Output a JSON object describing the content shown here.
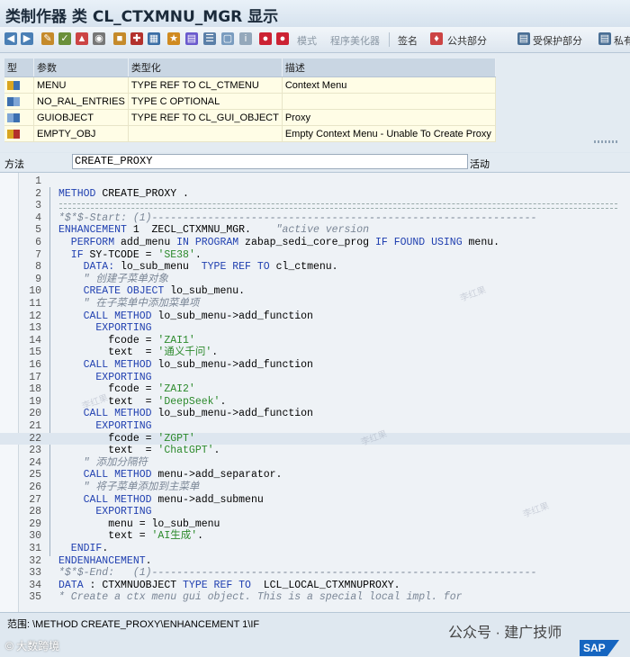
{
  "window": {
    "title": "类制作器 类 CL_CTXMNU_MGR 显示"
  },
  "toolbar": {
    "mode_label": "模式",
    "pretty_printer_label": "程序美化器",
    "signature_label": "签名",
    "public_section_label": "公共部分",
    "protected_section_label": "受保护部分",
    "private_section_label": "私有"
  },
  "params": {
    "headers": [
      "型",
      "参数",
      "类型化",
      "描述"
    ],
    "rows": [
      {
        "name": "MENU",
        "typing": "TYPE REF TO CL_CTMENU",
        "desc": "Context Menu"
      },
      {
        "name": "NO_RAL_ENTRIES",
        "typing": "TYPE C OPTIONAL",
        "desc": ""
      },
      {
        "name": "GUIOBJECT",
        "typing": "TYPE REF TO CL_GUI_OBJECT",
        "desc": "Proxy"
      },
      {
        "name": "EMPTY_OBJ",
        "typing": "",
        "desc": "Empty Context Menu - Unable To Create Proxy"
      }
    ]
  },
  "method_bar": {
    "label": "方法",
    "value": "CREATE_PROXY",
    "status": "活动"
  },
  "code_lines": [
    {
      "n": "1",
      "t": [
        [
          "",
          ""
        ]
      ]
    },
    {
      "n": "2",
      "t": [
        [
          "kw",
          "METHOD"
        ],
        [
          "plain",
          " CREATE_PROXY ."
        ]
      ]
    },
    {
      "n": "3",
      "t": [
        [
          "",
          ""
        ]
      ]
    },
    {
      "n": "4",
      "t": [
        [
          "cmt",
          "*$*$-Start: (1)--------------------------------------------------------------"
        ]
      ]
    },
    {
      "n": "5",
      "t": [
        [
          "kw",
          "ENHANCEMENT"
        ],
        [
          "plain",
          " 1  ZECL_CTXMNU_MGR.    "
        ],
        [
          "cmt",
          "\"active version"
        ]
      ]
    },
    {
      "n": "6",
      "t": [
        [
          "kw",
          "  PERFORM"
        ],
        [
          "plain",
          " add_menu "
        ],
        [
          "kw",
          "IN PROGRAM"
        ],
        [
          "plain",
          " zabap_sedi_core_prog "
        ],
        [
          "kw",
          "IF FOUND USING"
        ],
        [
          "plain",
          " menu."
        ]
      ]
    },
    {
      "n": "7",
      "t": [
        [
          "kw",
          "  IF"
        ],
        [
          "plain",
          " SY-TCODE = "
        ],
        [
          "str",
          "'SE38'"
        ],
        [
          "plain",
          "."
        ]
      ]
    },
    {
      "n": "8",
      "t": [
        [
          "kw",
          "    DATA:"
        ],
        [
          "plain",
          " lo_sub_menu  "
        ],
        [
          "kw",
          "TYPE REF TO"
        ],
        [
          "plain",
          " cl_ctmenu."
        ]
      ]
    },
    {
      "n": "9",
      "t": [
        [
          "cmt",
          "    \" 创建子菜单对象"
        ]
      ]
    },
    {
      "n": "10",
      "t": [
        [
          "kw",
          "    CREATE OBJECT"
        ],
        [
          "plain",
          " lo_sub_menu."
        ]
      ]
    },
    {
      "n": "11",
      "t": [
        [
          "cmt",
          "    \" 在子菜单中添加菜单项"
        ]
      ]
    },
    {
      "n": "12",
      "t": [
        [
          "kw",
          "    CALL METHOD"
        ],
        [
          "plain",
          " lo_sub_menu->add_function"
        ]
      ]
    },
    {
      "n": "13",
      "t": [
        [
          "kw",
          "      EXPORTING"
        ]
      ]
    },
    {
      "n": "14",
      "t": [
        [
          "plain",
          "        fcode = "
        ],
        [
          "str",
          "'ZAI1'"
        ]
      ]
    },
    {
      "n": "15",
      "t": [
        [
          "plain",
          "        text  = "
        ],
        [
          "str",
          "'通义千问'"
        ],
        [
          "plain",
          "."
        ]
      ]
    },
    {
      "n": "16",
      "t": [
        [
          "kw",
          "    CALL METHOD"
        ],
        [
          "plain",
          " lo_sub_menu->add_function"
        ]
      ]
    },
    {
      "n": "17",
      "t": [
        [
          "kw",
          "      EXPORTING"
        ]
      ]
    },
    {
      "n": "18",
      "t": [
        [
          "plain",
          "        fcode = "
        ],
        [
          "str",
          "'ZAI2'"
        ]
      ]
    },
    {
      "n": "19",
      "t": [
        [
          "plain",
          "        text  = "
        ],
        [
          "str",
          "'DeepSeek'"
        ],
        [
          "plain",
          "."
        ]
      ]
    },
    {
      "n": "20",
      "t": [
        [
          "kw",
          "    CALL METHOD"
        ],
        [
          "plain",
          " lo_sub_menu->add_function"
        ]
      ]
    },
    {
      "n": "21",
      "t": [
        [
          "kw",
          "      EXPORTING"
        ]
      ]
    },
    {
      "n": "22",
      "t": [
        [
          "plain",
          "        fcode = "
        ],
        [
          "str",
          "'ZGPT'"
        ]
      ]
    },
    {
      "n": "23",
      "t": [
        [
          "plain",
          "        text  = "
        ],
        [
          "str",
          "'ChatGPT'"
        ],
        [
          "plain",
          "."
        ]
      ]
    },
    {
      "n": "24",
      "t": [
        [
          "cmt",
          "    \" 添加分隔符"
        ]
      ]
    },
    {
      "n": "25",
      "t": [
        [
          "kw",
          "    CALL METHOD"
        ],
        [
          "plain",
          " menu->add_separator."
        ]
      ]
    },
    {
      "n": "26",
      "t": [
        [
          "cmt",
          "    \" 将子菜单添加到主菜单"
        ]
      ]
    },
    {
      "n": "27",
      "t": [
        [
          "kw",
          "    CALL METHOD"
        ],
        [
          "plain",
          " menu->add_submenu"
        ]
      ]
    },
    {
      "n": "28",
      "t": [
        [
          "kw",
          "      EXPORTING"
        ]
      ]
    },
    {
      "n": "29",
      "t": [
        [
          "plain",
          "        menu = lo_sub_menu"
        ]
      ]
    },
    {
      "n": "30",
      "t": [
        [
          "plain",
          "        text = "
        ],
        [
          "str",
          "'AI生成'"
        ],
        [
          "plain",
          "."
        ]
      ]
    },
    {
      "n": "31",
      "t": [
        [
          "kw",
          "  ENDIF"
        ],
        [
          "plain",
          "."
        ]
      ]
    },
    {
      "n": "32",
      "t": [
        [
          "kw",
          "ENDENHANCEMENT"
        ],
        [
          "plain",
          "."
        ]
      ]
    },
    {
      "n": "33",
      "t": [
        [
          "cmt",
          "*$*$-End:   (1)--------------------------------------------------------------"
        ]
      ]
    },
    {
      "n": "34",
      "t": [
        [
          "kw",
          "DATA"
        ],
        [
          "plain",
          " : CTXMNUOBJECT "
        ],
        [
          "kw",
          "TYPE REF TO"
        ],
        [
          "plain",
          "  LCL_LOCAL_CTXMNUPROXY."
        ]
      ]
    },
    {
      "n": "35",
      "t": [
        [
          "cmt",
          "* Create a ctx menu gui object. This is a special local impl. for"
        ]
      ]
    }
  ],
  "scope": {
    "text": "范围:  \\METHOD CREATE_PROXY\\ENHANCEMENT 1\\IF"
  },
  "overlay": {
    "wechat_text": "公众号 · 建广技师",
    "sap_logo": "SAP",
    "credit": "© 大数跨境",
    "watermark": "李红果"
  }
}
